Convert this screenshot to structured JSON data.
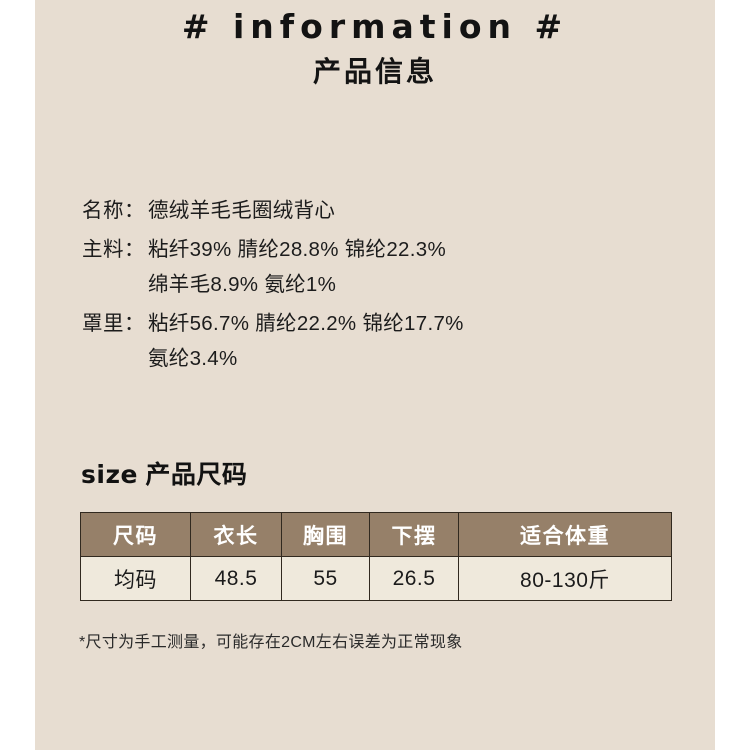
{
  "header": {
    "title": "# information #",
    "subtitle": "产品信息"
  },
  "info": {
    "rows": [
      {
        "label": "名称：",
        "value": "德绒羊毛毛圈绒背心"
      },
      {
        "label": "主料：",
        "value": "粘纤39% 腈纶28.8% 锦纶22.3%"
      },
      {
        "label": "",
        "value": "绵羊毛8.9% 氨纶1%"
      },
      {
        "label": "罩里：",
        "value": "粘纤56.7% 腈纶22.2% 锦纶17.7%"
      },
      {
        "label": "",
        "value": "氨纶3.4%"
      }
    ]
  },
  "size_section": {
    "heading_latin": "size",
    "heading_cn": " 产品尺码",
    "table": {
      "headers": [
        "尺码",
        "衣长",
        "胸围",
        "下摆",
        "适合体重"
      ],
      "rows": [
        [
          "均码",
          "48.5",
          "55",
          "26.5",
          "80-130斤"
        ]
      ]
    },
    "footnote": "*尺寸为手工测量，可能存在2CM左右误差为正常现象"
  },
  "colors": {
    "panel_background": "#e7ddd1",
    "table_header_background": "#968069",
    "table_header_text": "#ffffff",
    "table_cell_background": "#efe9dc",
    "border": "#31291f",
    "text": "#1c1c1c"
  }
}
